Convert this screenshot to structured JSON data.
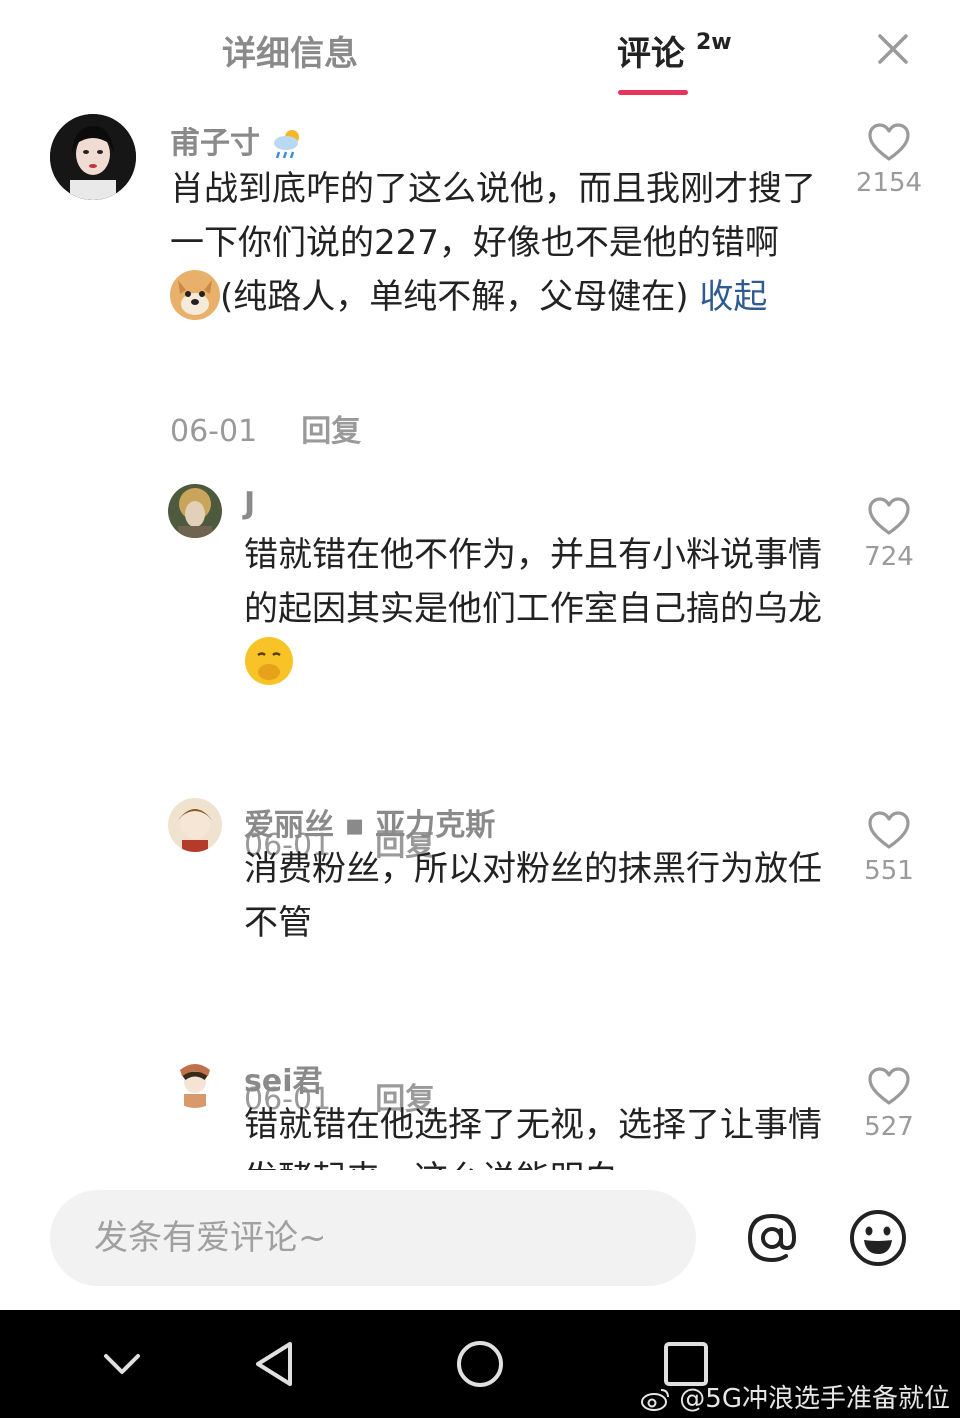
{
  "tabs": {
    "details": "详细信息",
    "comments": "评论",
    "comments_badge": "2w"
  },
  "comments": [
    {
      "user": "甫子寸",
      "text": "肖战到底咋的了这么说他，而且我刚才搜了一下你们说的227，好像也不是他的错啊",
      "text_tail": "(纯路人，单纯不解，父母健在)",
      "collapse": "收起",
      "date": "06-01",
      "reply": "回复",
      "likes": "2154"
    },
    {
      "user": "J",
      "text": "错就错在他不作为，并且有小料说事情的起因其实是他们工作室自己搞的乌龙",
      "date": "06-01",
      "reply": "回复",
      "likes": "724"
    },
    {
      "user": "爱丽丝 ▪ 亚力克斯",
      "text": "消费粉丝，所以对粉丝的抹黑行为放任不管",
      "date": "06-01",
      "reply": "回复",
      "likes": "551"
    },
    {
      "user": "sei君",
      "text": "错就错在他选择了无视，选择了让事情发酵起来，这么说能明白",
      "likes": "527"
    }
  ],
  "input": {
    "placeholder": "发条有爱评论~"
  },
  "watermark": "@5G冲浪选手准备就位",
  "colors": {
    "accent": "#e8335a",
    "link": "#2f5b93"
  }
}
